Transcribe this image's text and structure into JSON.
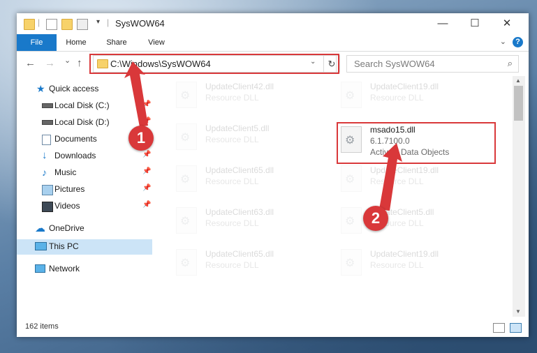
{
  "window": {
    "title": "SysWOW64",
    "controls": {
      "minimize": "—",
      "maximize": "☐",
      "close": "✕"
    }
  },
  "ribbon": {
    "tabs": [
      "File",
      "Home",
      "Share",
      "View"
    ],
    "help": "?"
  },
  "navbar": {
    "back": "←",
    "forward": "→",
    "recent": "⌄",
    "up": "↑",
    "address": "C:\\Windows\\SysWOW64",
    "address_dropdown": "⌄",
    "refresh": "↻",
    "search_placeholder": "Search SysWOW64",
    "search_icon": "⌕"
  },
  "sidebar": {
    "items": [
      {
        "label": "Quick access",
        "icon": "star-icon",
        "pinned": false
      },
      {
        "label": "Local Disk (C:)",
        "icon": "drive-icon",
        "pinned": true
      },
      {
        "label": "Local Disk (D:)",
        "icon": "drive-icon",
        "pinned": true
      },
      {
        "label": "Documents",
        "icon": "documents-icon",
        "pinned": true
      },
      {
        "label": "Downloads",
        "icon": "download-icon",
        "pinned": true
      },
      {
        "label": "Music",
        "icon": "music-icon",
        "pinned": true
      },
      {
        "label": "Pictures",
        "icon": "pictures-icon",
        "pinned": true
      },
      {
        "label": "Videos",
        "icon": "videos-icon",
        "pinned": true
      },
      {
        "label": "OneDrive",
        "icon": "cloud-icon",
        "pinned": false
      },
      {
        "label": "This PC",
        "icon": "computer-icon",
        "pinned": false,
        "selected": true
      },
      {
        "label": "Network",
        "icon": "network-icon",
        "pinned": false
      }
    ]
  },
  "files": [
    {
      "name": "UpdateClient42.dll",
      "desc": "Resource DLL"
    },
    {
      "name": "UpdateClient19.dll",
      "desc": "Resource DLL"
    },
    {
      "name": "UpdateClient5.dll",
      "desc": "Resource DLL"
    },
    {
      "name": "msado15.dll",
      "version": "6.1.7100.0",
      "desc": "ActiveX Data Objects"
    },
    {
      "name": "UpdateClient65.dll",
      "desc": "Resource DLL"
    },
    {
      "name": "UpdateClient19.dll",
      "desc": "Resource DLL"
    },
    {
      "name": "UpdateClient63.dll",
      "desc": "Resource DLL"
    },
    {
      "name": "UpdateClient5.dll",
      "desc": "Resource DLL"
    },
    {
      "name": "UpdateClient65.dll",
      "desc": "Resource DLL"
    },
    {
      "name": "UpdateClient19.dll",
      "desc": "Resource DLL"
    }
  ],
  "status": {
    "item_count": "162 items"
  },
  "annotations": {
    "step1": "1",
    "step2": "2"
  },
  "colors": {
    "accent": "#1979ca",
    "highlight": "#d9383a",
    "selected": "#cce4f7"
  }
}
